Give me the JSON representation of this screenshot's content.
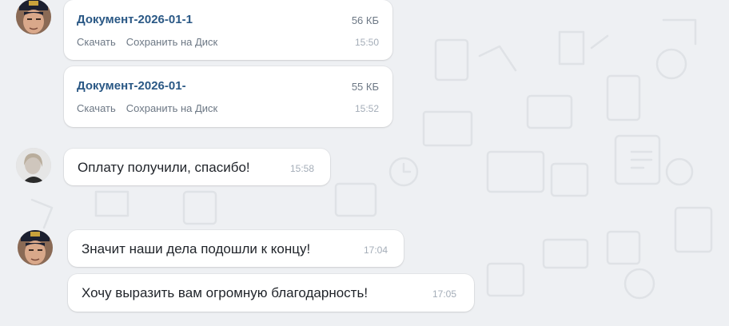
{
  "messages": [
    {
      "type": "file",
      "file_name": "Документ-2026-01-1",
      "size": "56 КБ",
      "download": "Скачать",
      "save_to_disk": "Сохранить на Диск",
      "time": "15:50"
    },
    {
      "type": "file",
      "file_name": "Документ-2026-01-",
      "size": "55 КБ",
      "download": "Скачать",
      "save_to_disk": "Сохранить на Диск",
      "time": "15:52"
    },
    {
      "type": "text",
      "text": "Оплату получили, спасибо!",
      "time": "15:58"
    },
    {
      "type": "text",
      "text": "Значит наши дела подошли к концу!",
      "time": "17:04"
    },
    {
      "type": "text",
      "text": "Хочу выразить вам огромную благодарность!",
      "time": "17:05"
    }
  ],
  "colors": {
    "background": "#eef0f3",
    "bubble": "#ffffff",
    "file_link": "#2a5885",
    "meta_text": "#6d7885",
    "time_text": "#a4adb8",
    "message_text": "#1f2329"
  },
  "icons": [
    "avatar-cartoon-captain",
    "avatar-woman-photo"
  ]
}
